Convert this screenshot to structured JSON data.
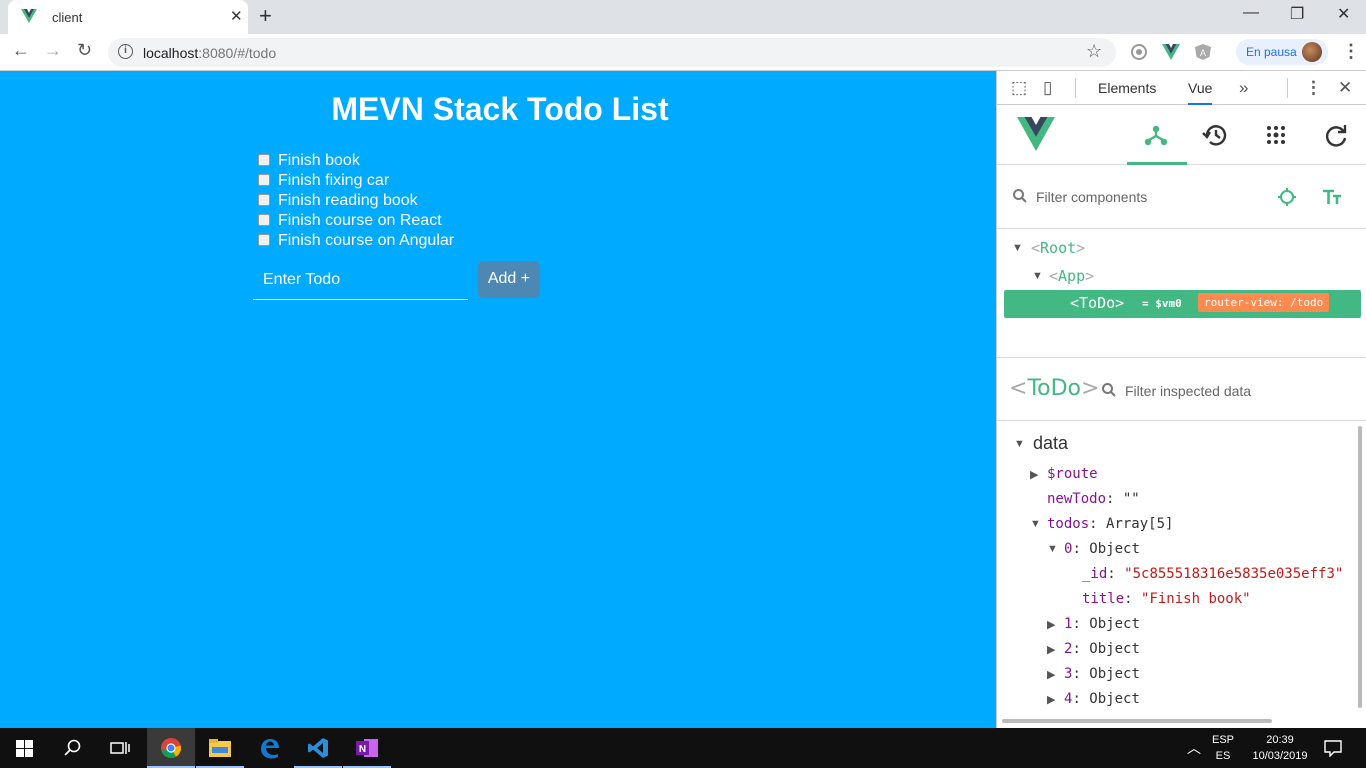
{
  "browser": {
    "tab_title": "client",
    "url_host": "localhost",
    "url_path": ":8080/#/todo",
    "profile_label": "En pausa"
  },
  "app": {
    "title": "MEVN Stack Todo List",
    "todos": [
      "Finish book",
      "Finish fixing car",
      "Finish reading book",
      "Finish course on React",
      "Finish course on Angular"
    ],
    "input_placeholder": "Enter Todo",
    "add_label": "Add +"
  },
  "devtools": {
    "tabs": [
      "Elements",
      "Vue"
    ],
    "filter_components_placeholder": "Filter components",
    "tree": {
      "root": "Root",
      "app": "App",
      "selected": "ToDo",
      "selected_ref": "= $vm0",
      "badge": "router-view: /todo"
    },
    "inspected_component": "ToDo",
    "filter_data_placeholder": "Filter inspected data",
    "data_header": "data",
    "data": {
      "route_key": "$route",
      "newTodo_key": "newTodo",
      "newTodo_val": "\"\"",
      "todos_key": "todos",
      "todos_val": "Array[5]",
      "item0_key": "0",
      "item0_val": "Object",
      "id_key": "_id",
      "id_val": "\"5c855518316e5835e035eff3\"",
      "title_key": "title",
      "title_val": "\"Finish book\"",
      "items": [
        {
          "key": "1",
          "val": "Object"
        },
        {
          "key": "2",
          "val": "Object"
        },
        {
          "key": "3",
          "val": "Object"
        },
        {
          "key": "4",
          "val": "Object"
        }
      ]
    }
  },
  "taskbar": {
    "lang_line1": "ESP",
    "lang_line2": "ES",
    "time": "20:39",
    "date": "10/03/2019"
  },
  "colors": {
    "page_bg": "#00aaff",
    "vue_green": "#42b883",
    "button_bg": "#4d88b4",
    "badge": "#ff8a50"
  }
}
